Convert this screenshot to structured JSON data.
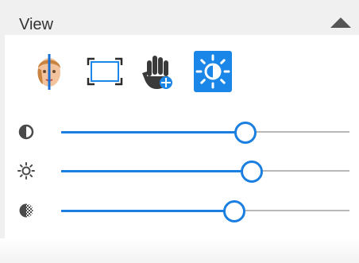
{
  "panel": {
    "title": "View",
    "accent_color": "#1a86e8"
  },
  "toolbar": {
    "tools": [
      {
        "icon": "face-split-icon",
        "active": false
      },
      {
        "icon": "fit-frame-icon",
        "active": false
      },
      {
        "icon": "hand-pan-icon",
        "active": false
      },
      {
        "icon": "brightness-adjust-icon",
        "active": true
      }
    ]
  },
  "sliders": [
    {
      "icon": "contrast-icon",
      "value": 0.64
    },
    {
      "icon": "brightness-icon",
      "value": 0.66
    },
    {
      "icon": "transparency-icon",
      "value": 0.6
    }
  ]
}
